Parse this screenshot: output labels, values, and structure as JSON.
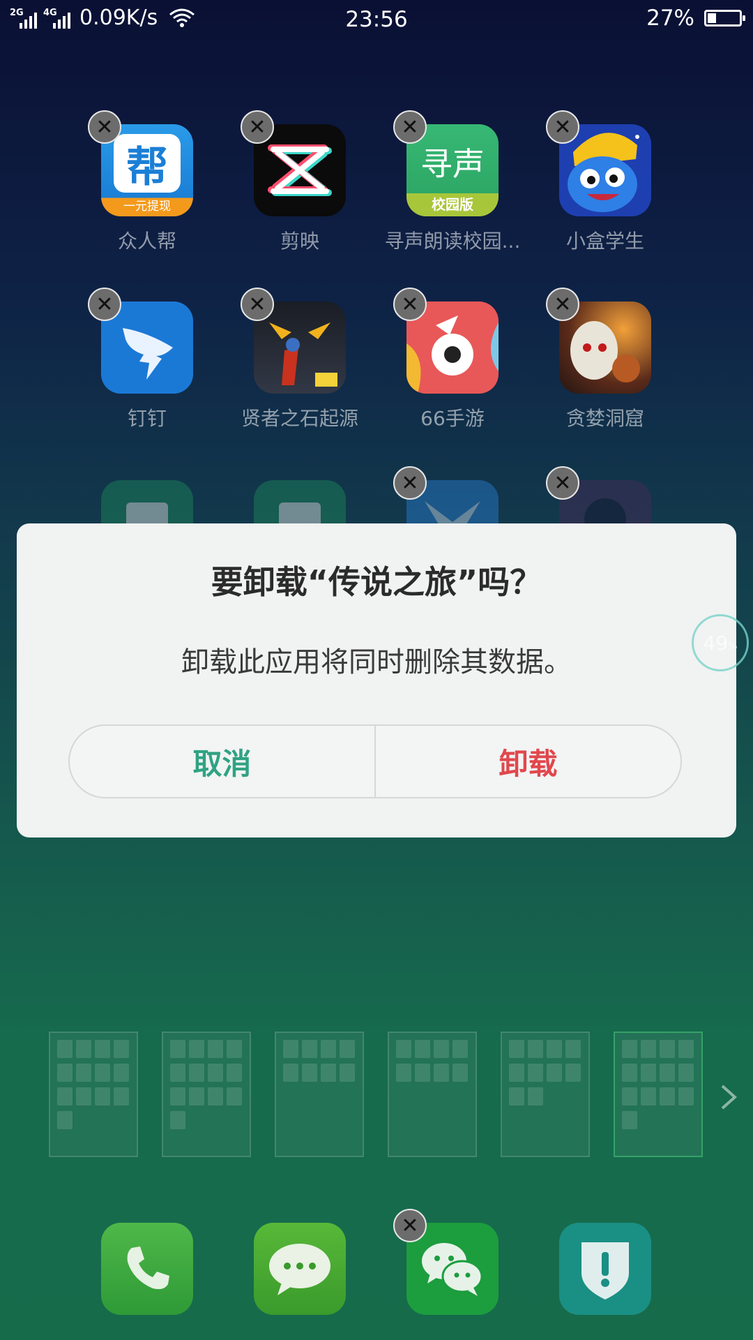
{
  "status_bar": {
    "sim1": "2G",
    "sim2": "4G",
    "speed": "0.09K/s",
    "time": "23:56",
    "battery": "27%",
    "battery_level": 0.27
  },
  "apps": [
    {
      "label": "众人帮",
      "icon_text": "帮",
      "icon_sub": "一元提现"
    },
    {
      "label": "剪映"
    },
    {
      "label": "寻声朗读校园...",
      "icon_text": "寻声",
      "icon_sub": "校园版"
    },
    {
      "label": "小盒学生"
    },
    {
      "label": "钉钉"
    },
    {
      "label": "贤者之石起源"
    },
    {
      "label": "66手游"
    },
    {
      "label": "贪婪洞窟"
    }
  ],
  "dialog": {
    "title": "要卸载“传说之旅”吗？",
    "message": "卸载此应用将同时删除其数据。",
    "cancel": "取消",
    "uninstall": "卸载"
  },
  "bubble": {
    "value": "49",
    "unit": "%"
  },
  "icons": {
    "remove": "close-icon",
    "dock": [
      "phone-icon",
      "messages-icon",
      "wechat-icon",
      "security-icon"
    ],
    "nav": "chevron-right-icon"
  },
  "colors": {
    "cancel": "#2fa383",
    "uninstall": "#e0484d",
    "dialog_bg": "#f1f2f2"
  }
}
